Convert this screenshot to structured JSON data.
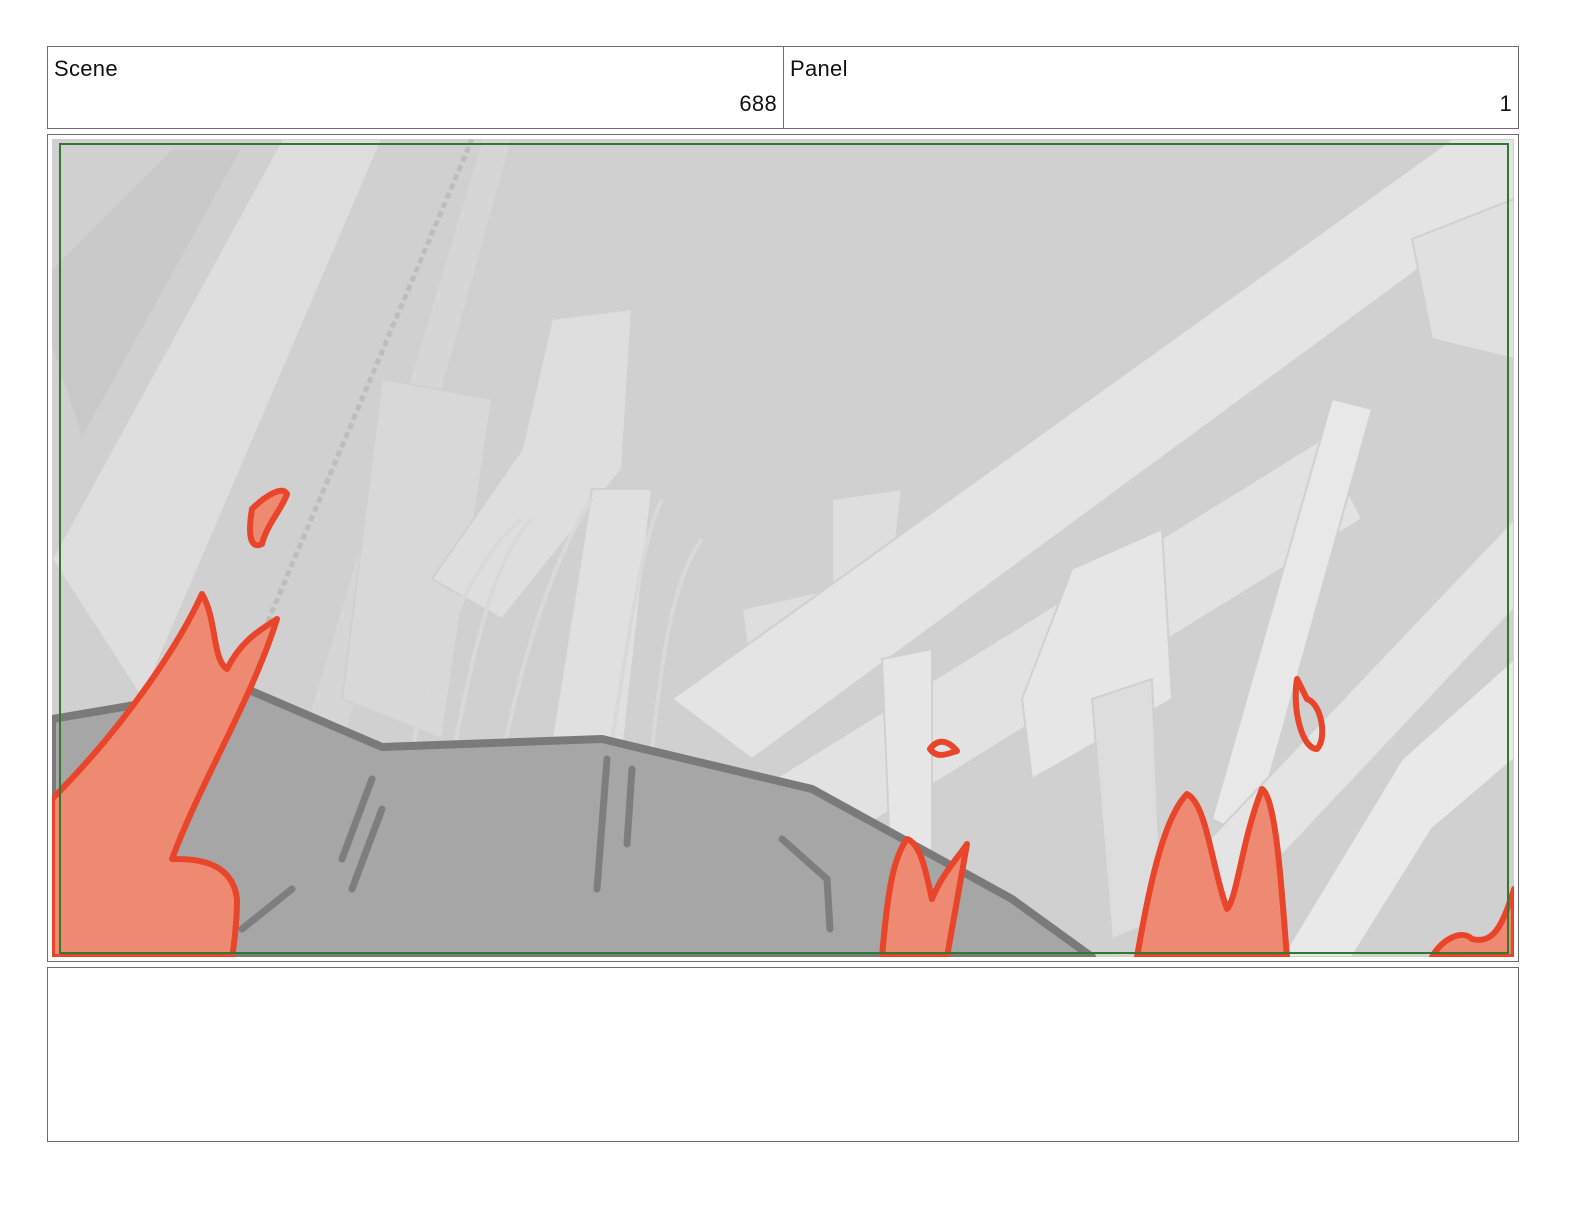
{
  "header": {
    "scene_label": "Scene",
    "scene_number": "688",
    "panel_label": "Panel",
    "panel_number": "1"
  },
  "panel_image": {
    "description_colors": {
      "sky": "#cfd0cf",
      "pipes": "#e3e3e3",
      "rock": "#a6a6a6",
      "rock_outline": "#7a7a7a",
      "fire_fill": "#ee8a72",
      "fire_stroke": "#e8452a",
      "safe_area": "#2f7a2f"
    }
  },
  "notes": {
    "text": ""
  }
}
